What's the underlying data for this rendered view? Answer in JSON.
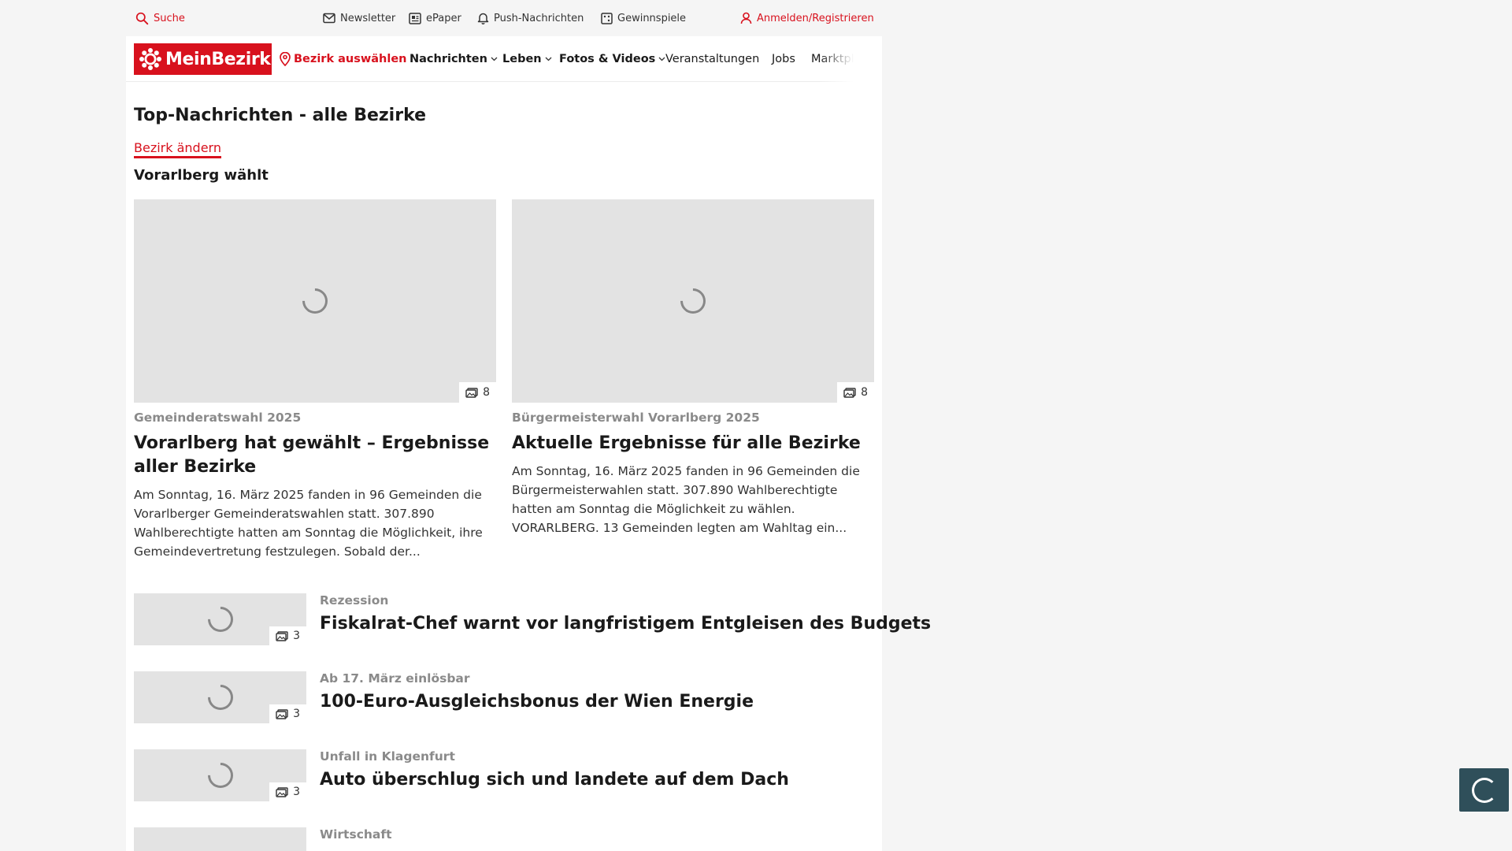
{
  "topbar": {
    "search": "Suche",
    "newsletter": "Newsletter",
    "epaper": "ePaper",
    "push": "Push-Nachrichten",
    "gewinnspiele": "Gewinnspiele",
    "login": "Anmelden/Registrieren"
  },
  "nav": {
    "logo": "MeinBezirk",
    "bezirk": "Bezirk auswählen",
    "items": [
      "Nachrichten",
      "Leben",
      "Fotos & Videos",
      "Veranstaltungen",
      "Jobs",
      "Marktplatz"
    ]
  },
  "main": {
    "heading": "Top-Nachrichten - alle Bezirke",
    "change_link": "Bezirk ändern",
    "section_title": "Vorarlberg wählt"
  },
  "features": [
    {
      "image_count": "8",
      "kicker": "Gemeinderatswahl 2025",
      "title": "Vorarlberg hat gewählt – Ergebnisse aller Bezirke",
      "teaser": "Am Sonntag, 16. März 2025 fanden in 96 Gemeinden die Vorarlberger Gemeinderatswahlen statt. 307.890 Wahlberechtigte hatten am Sonntag die Möglichkeit, ihre Gemeindevertretung festzulegen. Sobald der..."
    },
    {
      "image_count": "8",
      "kicker": "Bürgermeisterwahl Vorarlberg 2025",
      "title": "Aktuelle Ergebnisse für alle Bezirke",
      "teaser": "Am Sonntag, 16. März 2025 fanden in 96 Gemeinden die Bürgermeisterwahlen statt. 307.890 Wahlberechtigte hatten am Sonntag die Möglichkeit zu wählen. VORARLBERG. 13 Gemeinden legten am Wahltag ein..."
    }
  ],
  "articles": [
    {
      "image_count": "3",
      "kicker": "Rezession",
      "title": "Fiskalrat-Chef warnt vor langfristigem Entgleisen des Budgets"
    },
    {
      "image_count": "3",
      "kicker": "Ab 17. März einlösbar",
      "title": "100-Euro-Ausgleichsbonus der Wien Energie"
    },
    {
      "image_count": "3",
      "kicker": "Unfall in Klagenfurt",
      "title": "Auto überschlug sich und landete auf dem Dach"
    },
    {
      "kicker": "Wirtschaft"
    }
  ],
  "colors": {
    "brand": "#d8111d",
    "loader": "#2f4f5a"
  }
}
